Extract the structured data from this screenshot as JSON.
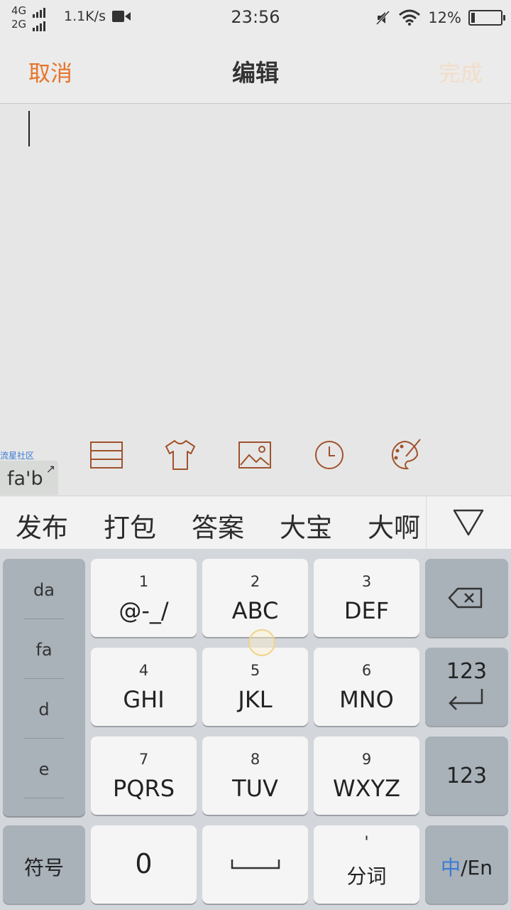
{
  "status_bar": {
    "network_1": "4G",
    "network_2": "2G",
    "speed": "1.1K/s",
    "time": "23:56",
    "battery_text": "12%",
    "battery_level": 0.12,
    "icons": [
      "signal-icon",
      "video-icon",
      "mute-icon",
      "wifi-icon",
      "battery-icon"
    ]
  },
  "nav": {
    "cancel": "取消",
    "title": "编辑",
    "done": "完成"
  },
  "colors": {
    "accent": "#e8742a",
    "done_disabled": "#f2ddc8",
    "toolbar_icon": "#a0522d",
    "link": "#3a7bd5"
  },
  "toolbar": {
    "watermark": "流星社区",
    "pinyin_preview": "fa'b",
    "icons": [
      "list-icon",
      "shirt-icon",
      "image-icon",
      "clock-icon",
      "palette-icon"
    ]
  },
  "candidates": [
    "发布",
    "打包",
    "答案",
    "大宝",
    "大啊"
  ],
  "keyboard": {
    "left_column": [
      "da",
      "fa",
      "d",
      "e"
    ],
    "keys": [
      {
        "num": "1",
        "label": "@-_/"
      },
      {
        "num": "2",
        "label": "ABC"
      },
      {
        "num": "3",
        "label": "DEF"
      },
      {
        "num": "4",
        "label": "GHI"
      },
      {
        "num": "5",
        "label": "JKL"
      },
      {
        "num": "6",
        "label": "MNO"
      },
      {
        "num": "7",
        "label": "PQRS"
      },
      {
        "num": "8",
        "label": "TUV"
      },
      {
        "num": "9",
        "label": "WXYZ"
      }
    ],
    "enter_label": "123",
    "numeric_label": "123",
    "symbols_label": "符号",
    "zero_label": "0",
    "segment_label": "分词",
    "segment_mark": "'",
    "lang_zh": "中",
    "lang_sep": "/En"
  }
}
